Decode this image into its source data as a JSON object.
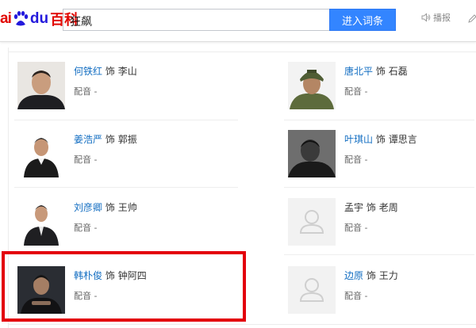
{
  "header": {
    "logo_left": "ai",
    "logo_du": "du",
    "logo_baike": "百科",
    "search_value": "狂飙",
    "search_button": "进入词条",
    "broadcast_label": "播报"
  },
  "cast": [
    {
      "actor": "何铁红",
      "verb": "饰",
      "role": "李山",
      "dub_label": "配音",
      "dub_value": "-",
      "link": true
    },
    {
      "actor": "唐北平",
      "verb": "饰",
      "role": "石磊",
      "dub_label": "配音",
      "dub_value": "-",
      "link": true
    },
    {
      "actor": "姜浩严",
      "verb": "饰",
      "role": "郭振",
      "dub_label": "配音",
      "dub_value": "-",
      "link": true
    },
    {
      "actor": "叶琪山",
      "verb": "饰",
      "role": "谭思言",
      "dub_label": "配音",
      "dub_value": "-",
      "link": true
    },
    {
      "actor": "刘彦卿",
      "verb": "饰",
      "role": "王帅",
      "dub_label": "配音",
      "dub_value": "-",
      "link": true
    },
    {
      "actor": "孟宇",
      "verb": "饰",
      "role": "老周",
      "dub_label": "配音",
      "dub_value": "-",
      "link": false
    },
    {
      "actor": "韩朴俊",
      "verb": "饰",
      "role": "钟阿四",
      "dub_label": "配音",
      "dub_value": "-",
      "link": true
    },
    {
      "actor": "边原",
      "verb": "饰",
      "role": "王力",
      "dub_label": "配音",
      "dub_value": "-",
      "link": true
    }
  ],
  "colors": {
    "brand_red": "#e10601",
    "brand_blue": "#2319dc",
    "link": "#136ec2",
    "button": "#3385ff",
    "highlight": "#e3000b"
  }
}
